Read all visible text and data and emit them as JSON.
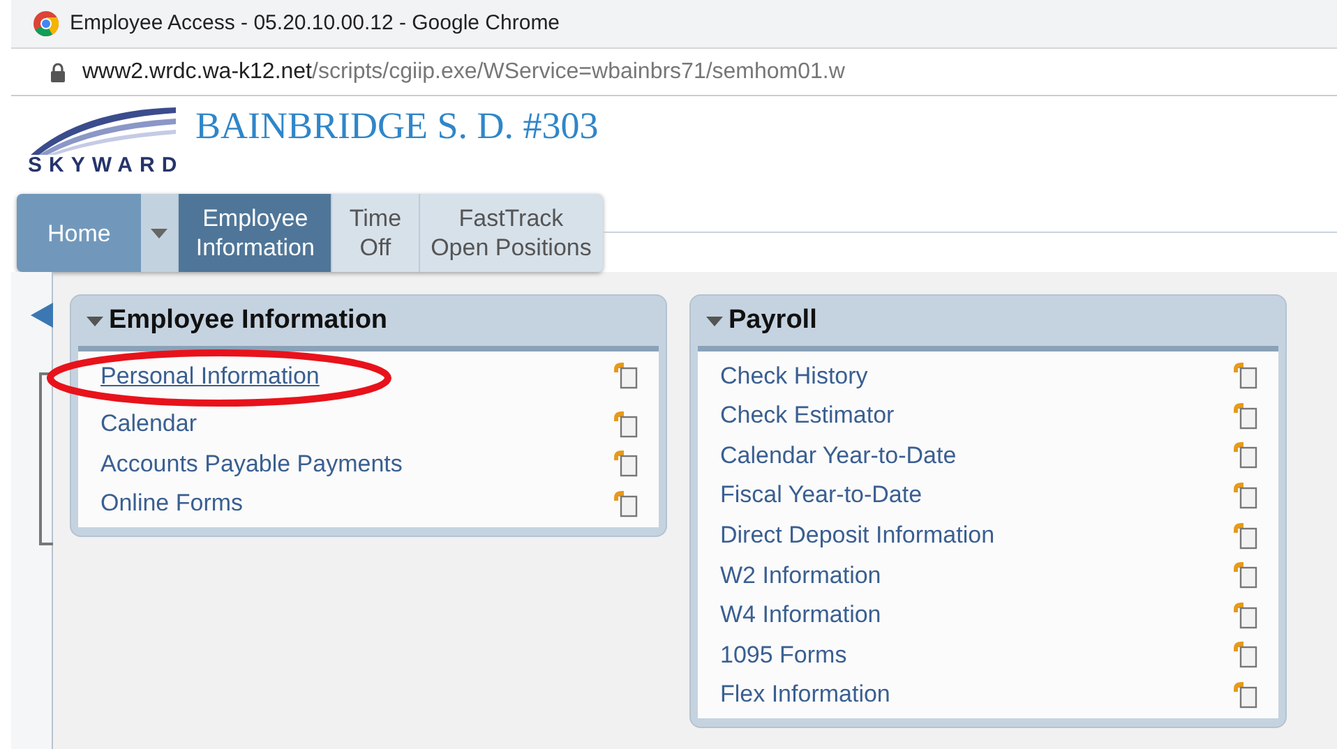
{
  "window": {
    "title": "Employee Access - 05.20.10.00.12 - Google Chrome"
  },
  "address_bar": {
    "host": "www2.wrdc.wa-k12.net",
    "path": "/scripts/cgiip.exe/WService=wbainbrs71/semhom01.w"
  },
  "header": {
    "logo_text": "SKYWARD",
    "district": "BAINBRIDGE S. D. #303"
  },
  "tabs": [
    {
      "label": "Home",
      "selected": false,
      "kind": "home"
    },
    {
      "label": "Employee Information",
      "selected": true,
      "kind": "tab"
    },
    {
      "label": "Time Off",
      "selected": false,
      "kind": "tab"
    },
    {
      "label": "FastTrack Open Positions",
      "selected": false,
      "kind": "tab"
    }
  ],
  "panels": [
    {
      "title": "Employee Information",
      "expanded": true,
      "items": [
        {
          "label": "Personal Information",
          "underlined": true
        },
        {
          "label": "Calendar",
          "underlined": false
        },
        {
          "label": "Accounts Payable Payments",
          "underlined": false
        },
        {
          "label": "Online Forms",
          "underlined": false
        }
      ]
    },
    {
      "title": "Payroll",
      "expanded": true,
      "items": [
        {
          "label": "Check History",
          "underlined": false
        },
        {
          "label": "Check Estimator",
          "underlined": false
        },
        {
          "label": "Calendar Year-to-Date",
          "underlined": false
        },
        {
          "label": "Fiscal Year-to-Date",
          "underlined": false
        },
        {
          "label": "Direct Deposit Information",
          "underlined": false
        },
        {
          "label": "W2 Information",
          "underlined": false
        },
        {
          "label": "W4 Information",
          "underlined": false
        },
        {
          "label": "1095 Forms",
          "underlined": false
        },
        {
          "label": "Flex Information",
          "underlined": false
        }
      ]
    }
  ],
  "annotation": {
    "kind": "ellipse",
    "color": "#e8121b"
  }
}
